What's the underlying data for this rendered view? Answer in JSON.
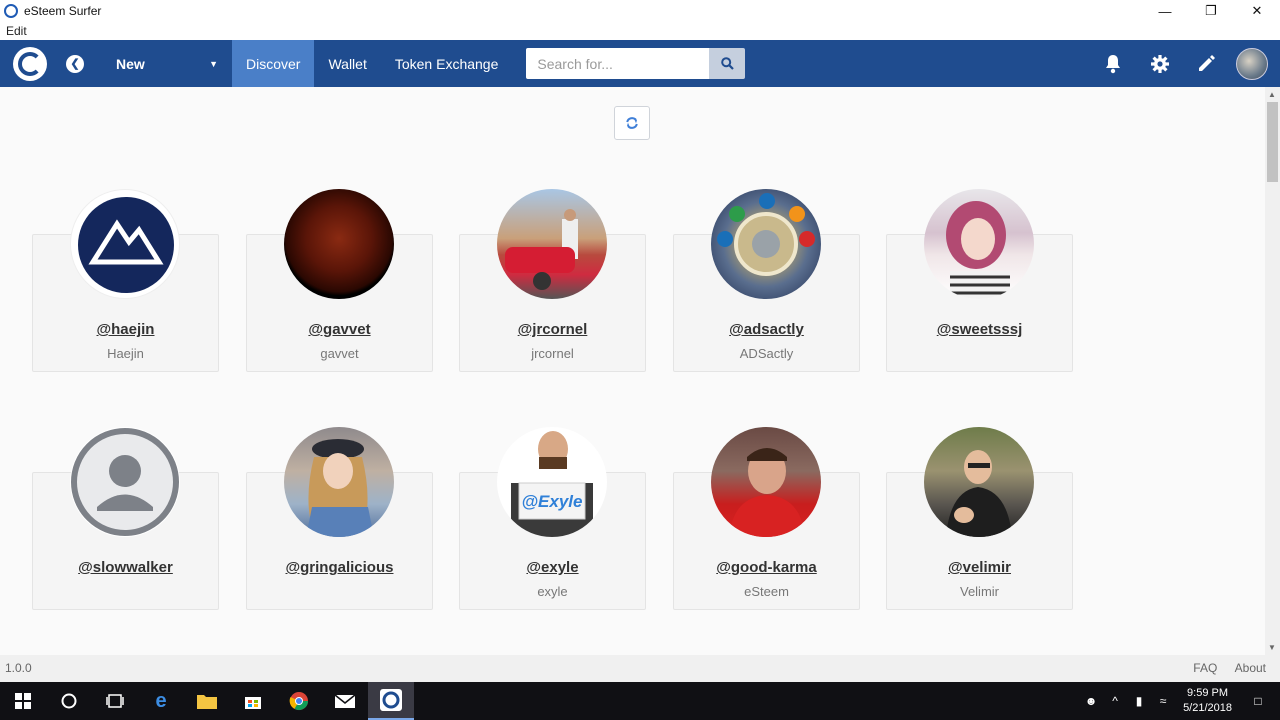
{
  "window": {
    "title": "eSteem Surfer",
    "menu": [
      "Edit"
    ],
    "controls": [
      "minimize",
      "restore",
      "close"
    ]
  },
  "navbar": {
    "filter_label": "New",
    "tabs": [
      {
        "label": "Discover",
        "active": true
      },
      {
        "label": "Wallet",
        "active": false
      },
      {
        "label": "Token Exchange",
        "active": false
      }
    ],
    "search_placeholder": "Search for...",
    "icons": [
      "bell-icon",
      "gear-icon",
      "pencil-icon",
      "user-avatar"
    ]
  },
  "users": [
    {
      "handle": "@haejin",
      "name": "Haejin",
      "avatar": "mountain-logo"
    },
    {
      "handle": "@gavvet",
      "name": "gavvet",
      "avatar": "red-moon"
    },
    {
      "handle": "@jrcornel",
      "name": "jrcornel",
      "avatar": "man-with-car"
    },
    {
      "handle": "@adsactly",
      "name": "ADSactly",
      "avatar": "crypto-coin"
    },
    {
      "handle": "@sweetsssj",
      "name": "",
      "avatar": "girl-portrait"
    },
    {
      "handle": "@slowwalker",
      "name": "",
      "avatar": "default-placeholder"
    },
    {
      "handle": "@gringalicious",
      "name": "",
      "avatar": "woman-with-hat"
    },
    {
      "handle": "@exyle",
      "name": "exyle",
      "avatar": "man-with-sign",
      "sign_text": "@Exyle"
    },
    {
      "handle": "@good-karma",
      "name": "eSteem",
      "avatar": "man-red-hoodie"
    },
    {
      "handle": "@velimir",
      "name": "Velimir",
      "avatar": "man-with-glasses"
    }
  ],
  "footer": {
    "version": "1.0.0",
    "links": [
      "FAQ",
      "About"
    ]
  },
  "taskbar": {
    "time": "9:59 PM",
    "date": "5/21/2018"
  },
  "colors": {
    "navbar": "#1f4c8f",
    "active_tab": "#4a7fc8",
    "background": "#fafafa"
  }
}
